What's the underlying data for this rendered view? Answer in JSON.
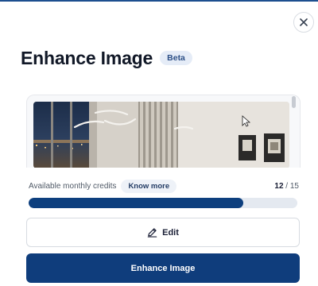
{
  "modal": {
    "title": "Enhance Image",
    "badge": "Beta"
  },
  "icons": {
    "close": "close-icon",
    "edit": "pencil-icon",
    "cursor": "mouse-pointer-icon"
  },
  "preview": {
    "image": "room-interior-photo"
  },
  "credits": {
    "label": "Available monthly credits",
    "know_more": "Know more",
    "used": "12",
    "separator": " / ",
    "total": "15",
    "progress_fraction": 0.8
  },
  "actions": {
    "edit_label": "Edit",
    "enhance_label": "Enhance Image"
  },
  "colors": {
    "primary": "#0f3d7c",
    "progress_fill": "#0d3f7e",
    "progress_track": "#e4e9f0",
    "badge_bg": "#e5ecf7"
  }
}
